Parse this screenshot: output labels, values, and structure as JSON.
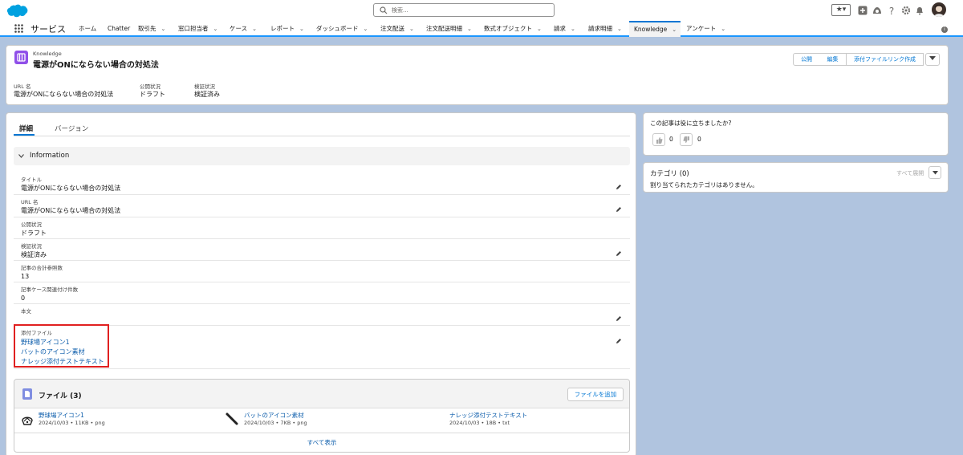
{
  "header": {
    "search_placeholder": "検索...",
    "star_glyph": "★▾",
    "icons": [
      "add-icon",
      "trailhead-icon",
      "help-icon",
      "gear-icon",
      "bell-icon",
      "avatar"
    ]
  },
  "nav": {
    "app_name": "サービス",
    "items": [
      {
        "label": "ホーム",
        "chevron": ""
      },
      {
        "label": "Chatter",
        "chevron": ""
      },
      {
        "label": "取引先",
        "chevron": "⌄"
      },
      {
        "label": "窓口担当者",
        "chevron": "⌄"
      },
      {
        "label": "ケース",
        "chevron": "⌄"
      },
      {
        "label": "レポート",
        "chevron": "⌄"
      },
      {
        "label": "ダッシュボード",
        "chevron": "⌄"
      },
      {
        "label": "注文配送",
        "chevron": "⌄"
      },
      {
        "label": "注文配送明細",
        "chevron": "⌄"
      },
      {
        "label": "数式オブジェクト",
        "chevron": "⌄"
      },
      {
        "label": "請求",
        "chevron": "⌄"
      },
      {
        "label": "請求明細",
        "chevron": "⌄"
      },
      {
        "label": "Knowledge",
        "chevron": "⌄"
      },
      {
        "label": "アンケート",
        "chevron": "⌄"
      }
    ],
    "active": "Knowledge"
  },
  "record": {
    "type": "Knowledge",
    "title": "電源がONにならない場合の対処法",
    "buttons": [
      "公開",
      "編集",
      "添付ファイルリンク作成"
    ],
    "highlights": [
      {
        "label": "URL 名",
        "value": "電源がONにならない場合の対処法"
      },
      {
        "label": "公開状況",
        "value": "ドラフト"
      },
      {
        "label": "検証状況",
        "value": "検証済み"
      }
    ]
  },
  "tabs": {
    "details": "詳細",
    "versions": "バージョン"
  },
  "section": {
    "title": "Information"
  },
  "fields": [
    {
      "label": "タイトル",
      "value": "電源がONにならない場合の対処法"
    },
    {
      "label": "URL 名",
      "value": "電源がONにならない場合の対処法"
    },
    {
      "label": "公開状況",
      "value": "ドラフト"
    },
    {
      "label": "検証状況",
      "value": "検証済み"
    },
    {
      "label": "記事の合計参照数",
      "value": "13"
    },
    {
      "label": "記事ケース関連付け件数",
      "value": "0"
    },
    {
      "label": "本文",
      "value": ""
    }
  ],
  "attachments": {
    "label": "添付ファイル",
    "links": [
      "野球場アイコン1",
      "バットのアイコン素材",
      "ナレッジ添付テストテキスト"
    ]
  },
  "files": {
    "title": "ファイル (3)",
    "add_button": "ファイルを追加",
    "items": [
      {
        "name": "野球場アイコン1",
        "meta": "2024/10/03 • 11KB • png"
      },
      {
        "name": "バットのアイコン素材",
        "meta": "2024/10/03 • 7KB • png"
      },
      {
        "name": "ナレッジ添付テストテキスト",
        "meta": "2024/10/03 • 18B • txt"
      }
    ],
    "view_all": "すべて表示"
  },
  "sidebar": {
    "helpful": {
      "question": "この記事は役に立ちましたか?",
      "up_count": "0",
      "down_count": "0"
    },
    "categories": {
      "title": "カテゴリ (0)",
      "expand": "すべて展開",
      "empty": "割り当てられたカテゴリはありません。"
    }
  },
  "colors": {
    "accent": "#0176d3",
    "brand_cloud": "#00a1e0",
    "knowledge_icon": "#9050e9",
    "highlight_box": "#e02020"
  }
}
